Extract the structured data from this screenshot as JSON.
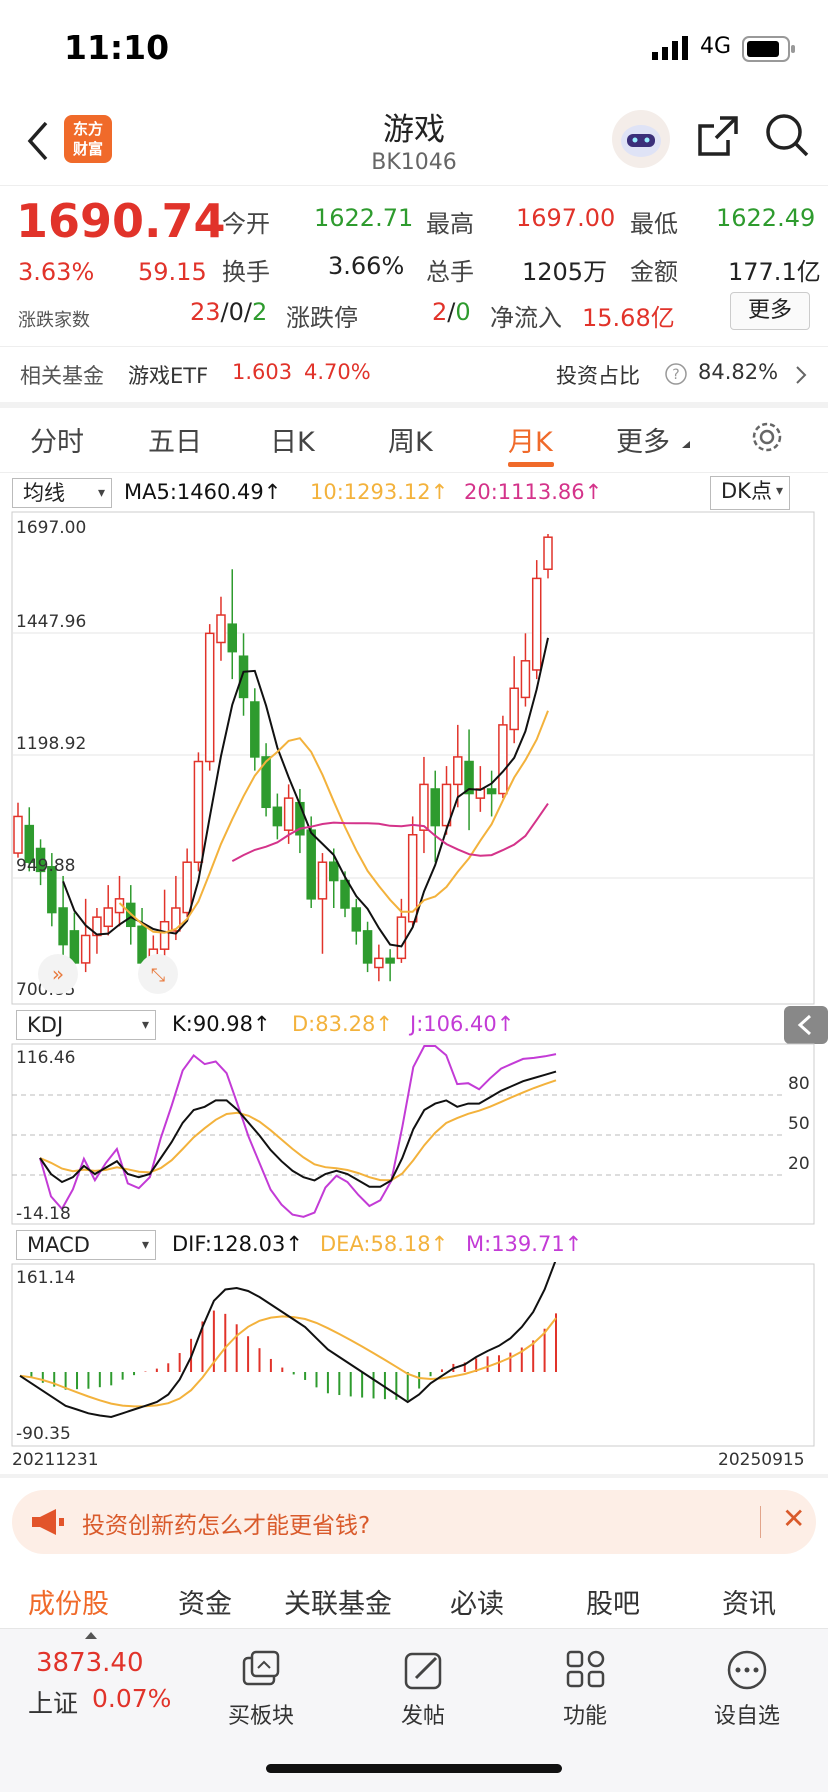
{
  "status_bar": {
    "time": "11:10",
    "network": "4G"
  },
  "header": {
    "title": "游戏",
    "code": "BK1046",
    "logo_text": "东方财富"
  },
  "quote": {
    "price": "1690.74",
    "change_pct": "3.63%",
    "change": "59.15",
    "open_label": "今开",
    "open": "1622.71",
    "high_label": "最高",
    "high": "1697.00",
    "low_label": "最低",
    "low": "1622.49",
    "turnover_label": "换手",
    "turnover": "3.66%",
    "volume_label": "总手",
    "volume": "1205万",
    "amount_label": "金额",
    "amount": "177.1亿",
    "breadth_label": "涨跌家数",
    "breadth_up": "23",
    "breadth_flat": "0",
    "breadth_down": "2",
    "limit_label": "涨跌停",
    "limit_up": "2",
    "limit_down": "0",
    "inflow_label": "净流入",
    "inflow": "15.68亿",
    "more_label": "更多"
  },
  "fund": {
    "label": "相关基金",
    "name": "游戏ETF",
    "price": "1.603",
    "pct": "4.70%",
    "ratio_label": "投资占比",
    "ratio": "84.82%"
  },
  "tabs": [
    "分时",
    "五日",
    "日K",
    "周K",
    "月K",
    "更多"
  ],
  "active_tab": "月K",
  "kline": {
    "selector": "均线",
    "ma5": "MA5:1460.49↑",
    "ma10": "10:1293.12↑",
    "ma20": "20:1113.86↑",
    "dk_label": "DK点",
    "y_labels": [
      "1697.00",
      "1447.96",
      "1198.92",
      "949.88",
      "700.85"
    ],
    "start_date": "20211231",
    "end_date": "20250915"
  },
  "kdj": {
    "selector": "KDJ",
    "k": "K:90.98↑",
    "d": "D:83.28↑",
    "j": "J:106.40↑",
    "y_max": "116.46",
    "y_min": "-14.18",
    "levels": [
      "80",
      "50",
      "20"
    ]
  },
  "macd": {
    "selector": "MACD",
    "dif": "DIF:128.03↑",
    "dea": "DEA:58.18↑",
    "m": "M:139.71↑",
    "y_max": "161.14",
    "y_min": "-90.35"
  },
  "banner": {
    "text": "投资创新药怎么才能更省钱?"
  },
  "bottom_tabs": [
    "成份股",
    "资金",
    "关联基金",
    "必读",
    "股吧",
    "资讯"
  ],
  "active_bottom_tab": "成份股",
  "bottom_bar": {
    "index_value": "3873.40",
    "index_name": "上证",
    "index_pct": "0.07%",
    "buttons": [
      "买板块",
      "发帖",
      "功能",
      "设自选"
    ]
  },
  "colors": {
    "up": "#e1332a",
    "down": "#2e9b2e",
    "accent": "#f06a2a",
    "ma5": "#111111",
    "ma10": "#f3b23c",
    "ma20": "#d4338a",
    "j": "#c33bd6"
  }
}
